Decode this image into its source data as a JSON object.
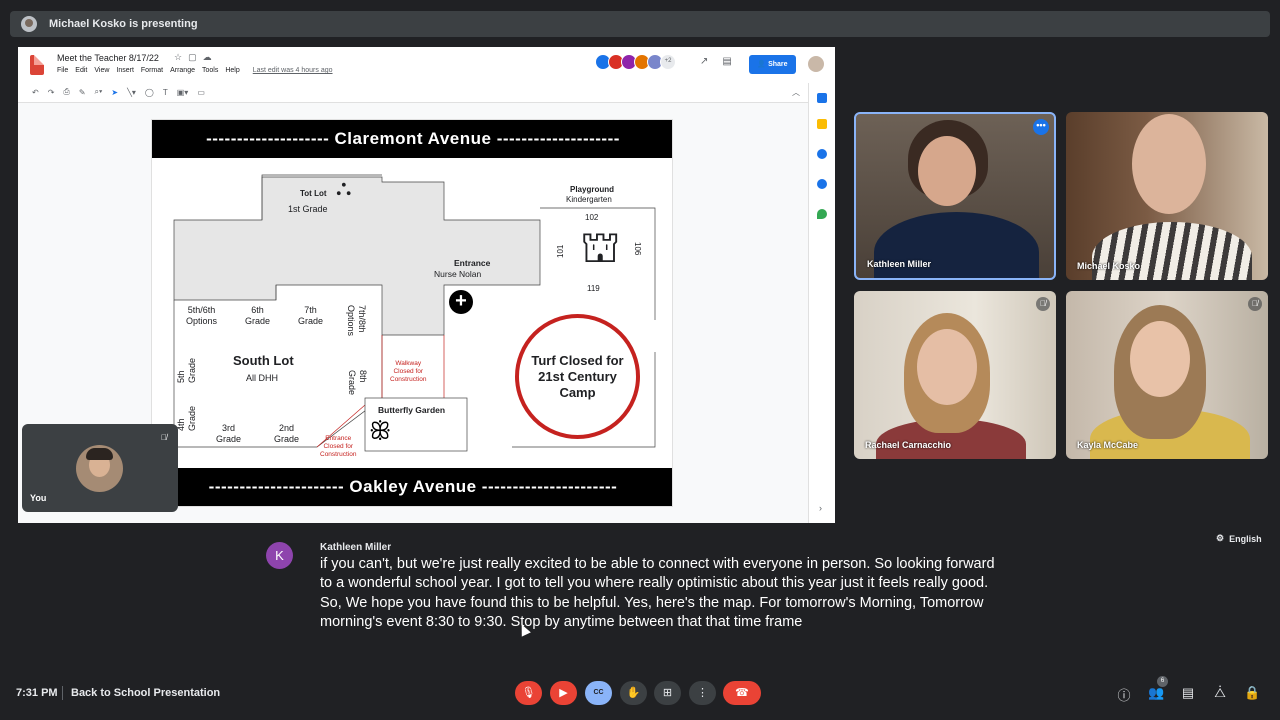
{
  "banner": {
    "text": "Michael Kosko is presenting"
  },
  "doc": {
    "title": "Meet the Teacher 8/17/22",
    "menu": [
      "File",
      "Edit",
      "View",
      "Insert",
      "Format",
      "Arrange",
      "Tools",
      "Help"
    ],
    "last_edit": "Last edit was 4 hours ago",
    "collaborators_more": "+2",
    "share_label": "Share",
    "brand_color": "#db4437",
    "accent": "#1a73e8"
  },
  "map": {
    "top_street": "-------------------- Claremont Avenue --------------------",
    "bottom_street": "---------------------- Oakley Avenue ----------------------",
    "tot_lot": "Tot Lot",
    "first_grade": "1st Grade",
    "playground": "Playground",
    "kindergarten": "Kindergarten",
    "room_102": "102",
    "room_101": "101",
    "room_106": "106",
    "room_119": "119",
    "entrance": "Entrance",
    "nurse": "Nurse Nolan",
    "options_56": "5th/6th\nOptions",
    "grade_6": "6th\nGrade",
    "grade_7": "7th\nGrade",
    "options_78": "7th/8th\nOptions",
    "south_lot": "South Lot",
    "all_dhh": "All DHH",
    "grade_5": "5th\nGrade",
    "grade_8": "8th\nGrade",
    "grade_4": "4th\nGrade",
    "grade_3": "3rd\nGrade",
    "grade_2": "2nd\nGrade",
    "walkway_closed": "Walkway\nClosed for\nConstruction",
    "entrance_closed": "Entrance\nClosed for\nConstruction",
    "butterfly_garden": "Butterfly Garden",
    "turf": "Turf Closed for 21st Century Camp"
  },
  "self": {
    "name": "You"
  },
  "participants": [
    {
      "name": "Kathleen Miller"
    },
    {
      "name": "Michael Kosko"
    },
    {
      "name": "Rachael Carnacchio"
    },
    {
      "name": "Kayla McCabe"
    }
  ],
  "captions": {
    "initial": "K",
    "speaker": "Kathleen Miller",
    "text": "if you can't, but we're just really excited to be able to connect with everyone in person. So looking forward to a wonderful school year. I got to tell you where really optimistic about this year just it feels really good. So, We hope you have found this to be helpful. Yes, here's the map. For tomorrow's Morning, Tomorrow morning's event 8:30 to 9:30. Stop by anytime between that that time frame",
    "language": "English"
  },
  "bottom": {
    "time": "7:31 PM",
    "meeting_title": "Back to School Presentation",
    "cc_label": "CC",
    "people_count": "6"
  }
}
